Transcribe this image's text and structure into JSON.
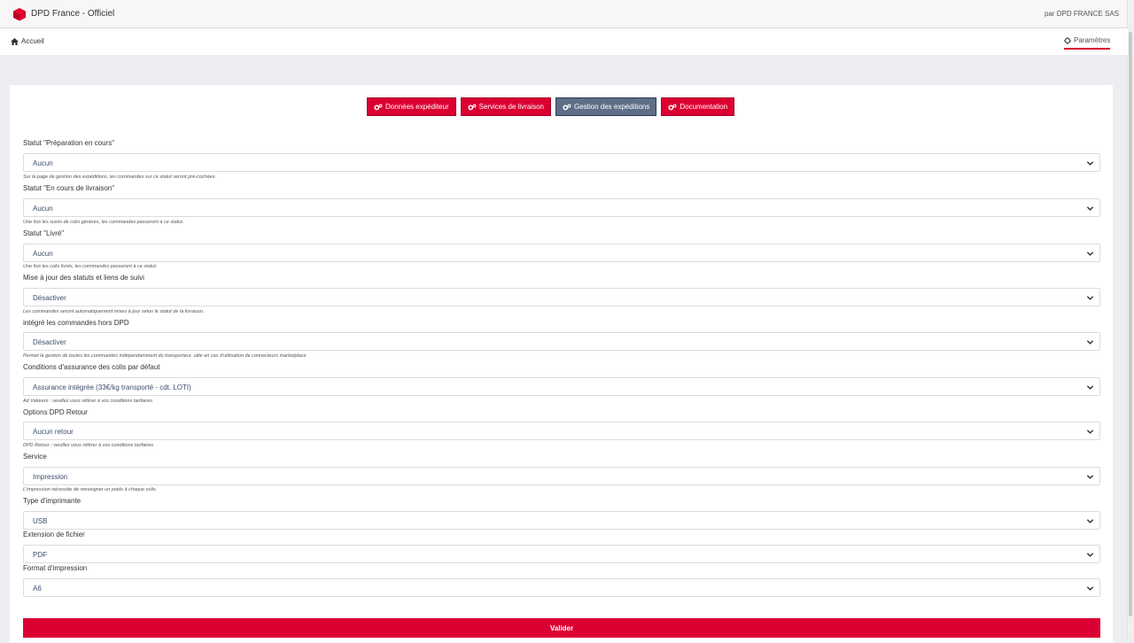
{
  "header": {
    "app_title": "DPD France - Officiel",
    "publisher": "par DPD FRANCE SAS"
  },
  "nav": {
    "home_label": "Accueil",
    "settings_label": "Paramètres"
  },
  "tabs": [
    {
      "label": "Données expéditeur",
      "active": false
    },
    {
      "label": "Services de livraison",
      "active": false
    },
    {
      "label": "Gestion des expéditions",
      "active": true
    },
    {
      "label": "Documentation",
      "active": false
    }
  ],
  "fields": [
    {
      "label": "Statut \"Préparation en cours\"",
      "value": "Aucun",
      "help": "Sur la page de gestion des expéditions, les commandes sur ce statut seront pré-cochées."
    },
    {
      "label": "Statut \"En cours de livraison\"",
      "value": "Aucun",
      "help": "Une fois les suivis de colis générés, les commandes passeront à ce statut."
    },
    {
      "label": "Statut \"Livré\"",
      "value": "Aucun",
      "help": "Une fois les colis livrés, les commandes passeront à ce statut."
    },
    {
      "label": "Mise à jour des statuts et liens de suivi",
      "value": "Désactiver",
      "help": "Les commandes seront automatiquement mises à jour selon le statut de la livraison."
    },
    {
      "label": "intégré les commandes hors DPD",
      "value": "Désactiver",
      "help": "Permet la gestion de toutes les commandes indépendamment du transporteur, utile en cas d'utilisation de connecteurs marketplace"
    },
    {
      "label": "Conditions d'assurance des colis par défaut",
      "value": "Assurance intégrée (33€/kg transporté - cdt. LOTI)",
      "help": "Ad Valorem : veuillez vous référer à vos conditions tarifaires."
    },
    {
      "label": "Options DPD Retour",
      "value": "Aucun retour",
      "help": "DPD Retour : veuillez vous référer à vos conditions tarifaires."
    },
    {
      "label": "Service",
      "value": "Impression",
      "help": "L'impression nécessite de renseigner un poids à chaque colis."
    },
    {
      "label": "Type d'imprimante",
      "value": "USB",
      "help": ""
    },
    {
      "label": "Extension de fichier",
      "value": "PDF",
      "help": ""
    },
    {
      "label": "Format d'impression",
      "value": "A6",
      "help": ""
    }
  ],
  "submit_label": "Valider",
  "colors": {
    "brand_red": "#dc0032",
    "active_tab": "#5e6e86",
    "page_bg": "#eceef2"
  },
  "icons": {
    "logo": "dpd-cube-logo",
    "home": "home-icon",
    "settings": "gear-icon",
    "tab": "gears-icon",
    "select": "chevron-down-icon"
  }
}
